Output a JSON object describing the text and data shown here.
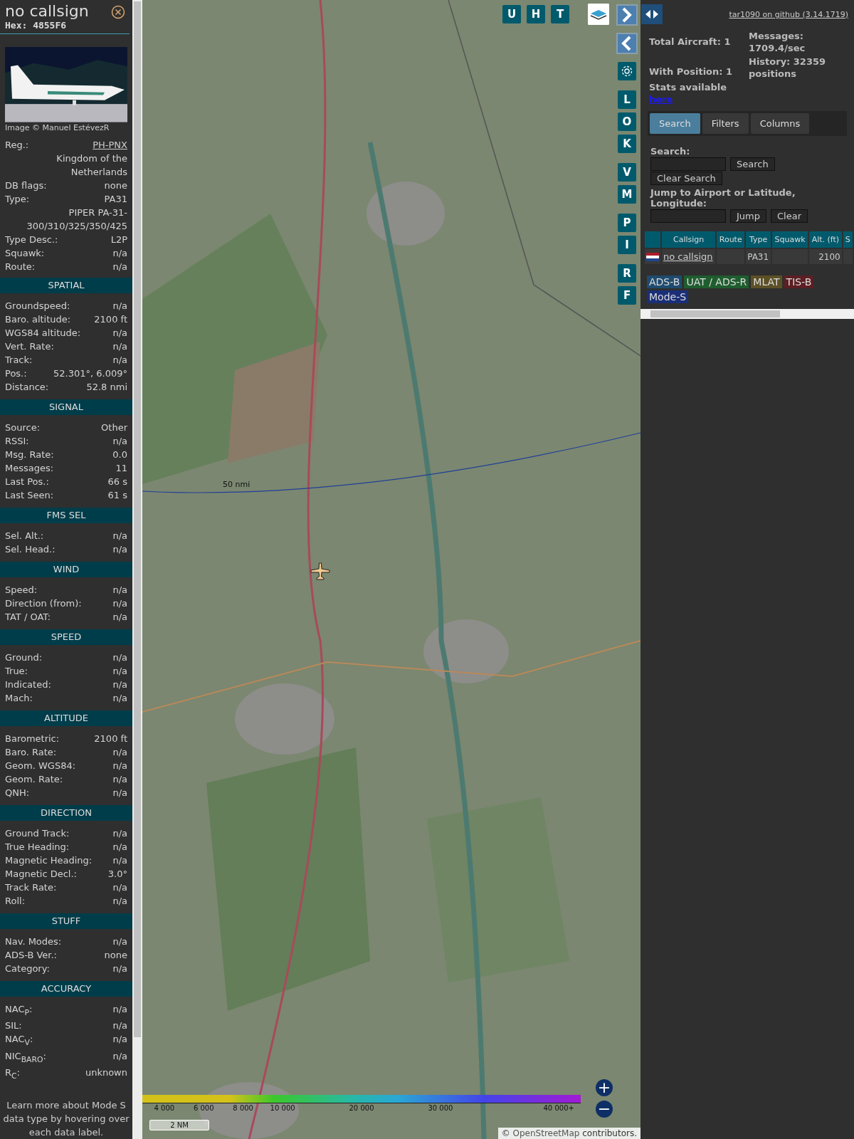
{
  "detail_panel": {
    "callsign": "no callsign",
    "hex": "Hex: 4855F6",
    "photo": {
      "kind": "picture",
      "credit": "Image © Manuel EstévezR"
    },
    "info_rows": [
      {
        "kind": "link",
        "label": "Reg.:",
        "value": "PH-PNX"
      },
      {
        "kind": "note",
        "value": "Kingdom of the Netherlands"
      },
      {
        "kind": "text",
        "label": "DB flags:",
        "value": "none"
      },
      {
        "kind": "text",
        "label": "Type:",
        "value": "PA31"
      },
      {
        "kind": "note",
        "value": "PIPER PA-31-300/310/325/350/425"
      },
      {
        "kind": "text",
        "label": "Type Desc.:",
        "value": "L2P"
      },
      {
        "kind": "text",
        "label": "Squawk:",
        "value": "n/a"
      },
      {
        "kind": "text",
        "label": "Route:",
        "value": "n/a"
      }
    ],
    "sections": [
      {
        "title": "SPATIAL",
        "rows": [
          {
            "label": "Groundspeed:",
            "value": "n/a"
          },
          {
            "label": "Baro. altitude:",
            "value": "2100 ft"
          },
          {
            "label": "WGS84 altitude:",
            "value": "n/a"
          },
          {
            "label": "Vert. Rate:",
            "value": "n/a"
          },
          {
            "label": "Track:",
            "value": "n/a"
          },
          {
            "label": "Pos.:",
            "value": "52.301°, 6.009°"
          },
          {
            "label": "Distance:",
            "value": "52.8 nmi"
          }
        ]
      },
      {
        "title": "SIGNAL",
        "rows": [
          {
            "label": "Source:",
            "value": "Other"
          },
          {
            "label": "RSSI:",
            "value": "n/a"
          },
          {
            "label": "Msg. Rate:",
            "value": "0.0"
          },
          {
            "label": "Messages:",
            "value": "11"
          },
          {
            "label": "Last Pos.:",
            "value": "66 s"
          },
          {
            "label": "Last Seen:",
            "value": "61 s"
          }
        ]
      },
      {
        "title": "FMS SEL",
        "rows": [
          {
            "label": "Sel. Alt.:",
            "value": "n/a"
          },
          {
            "label": "Sel. Head.:",
            "value": "n/a"
          }
        ]
      },
      {
        "title": "WIND",
        "rows": [
          {
            "label": "Speed:",
            "value": "n/a"
          },
          {
            "label": "Direction (from):",
            "value": "n/a"
          },
          {
            "label": "TAT / OAT:",
            "value": "n/a"
          }
        ]
      },
      {
        "title": "SPEED",
        "rows": [
          {
            "label": "Ground:",
            "value": "n/a"
          },
          {
            "label": "True:",
            "value": "n/a"
          },
          {
            "label": "Indicated:",
            "value": "n/a"
          },
          {
            "label": "Mach:",
            "value": "n/a"
          }
        ]
      },
      {
        "title": "ALTITUDE",
        "rows": [
          {
            "label": "Barometric:",
            "value": "2100 ft"
          },
          {
            "label": "Baro. Rate:",
            "value": "n/a"
          },
          {
            "label": "Geom. WGS84:",
            "value": "n/a"
          },
          {
            "label": "Geom. Rate:",
            "value": "n/a"
          },
          {
            "label": "QNH:",
            "value": "n/a"
          }
        ]
      },
      {
        "title": "DIRECTION",
        "rows": [
          {
            "label": "Ground Track:",
            "value": "n/a"
          },
          {
            "label": "True Heading:",
            "value": "n/a"
          },
          {
            "label": "Magnetic Heading:",
            "value": "n/a"
          },
          {
            "label": "Magnetic Decl.:",
            "value": "3.0°"
          },
          {
            "label": "Track Rate:",
            "value": "n/a"
          },
          {
            "label": "Roll:",
            "value": "n/a"
          }
        ]
      },
      {
        "title": "STUFF",
        "rows": [
          {
            "label": "Nav. Modes:",
            "value": "n/a"
          },
          {
            "label": "ADS-B Ver.:",
            "value": "none"
          },
          {
            "label": "Category:",
            "value": "n/a"
          }
        ]
      },
      {
        "title": "ACCURACY",
        "rows": [
          {
            "label": "NAC$_{P}$:",
            "value": "n/a"
          },
          {
            "label": "SIL:",
            "value": "n/a"
          },
          {
            "label": "NAC$_{V}$:",
            "value": "n/a"
          },
          {
            "label": "NIC$_{BARO}$:",
            "value": "n/a"
          },
          {
            "label": "R$_{C}$:",
            "value": "unknown"
          }
        ]
      }
    ],
    "footer": "Learn more about Mode S data type by hovering over each data label."
  },
  "map": {
    "kind": "picture",
    "top_buttons": [
      "U",
      "H",
      "T"
    ],
    "side_button_groups": [
      [
        "L",
        "O",
        "K"
      ],
      [
        "V",
        "M"
      ],
      [
        "P",
        "I"
      ],
      [
        "R",
        "F"
      ]
    ],
    "range_label": "50 nmi",
    "altitude_ticks": [
      "4 000",
      "6 000",
      "8 000",
      "10 000",
      "20 000",
      "30 000",
      "40 000+"
    ],
    "zoom_in": "+",
    "zoom_out": "−",
    "scale": "2 NM",
    "attribution": {
      "prefix": "©",
      "link": "OpenStreetMap",
      "suffix": "contributors."
    }
  },
  "side_panel": {
    "github_link": "tar1090 on github (3.14.1719)",
    "stats": {
      "total": "Total Aircraft: 1",
      "with_position": "With Position: 1",
      "stats_text": "Stats available",
      "stats_link": "here",
      "messages_label": "Messages:",
      "messages_value": "1709.4/sec",
      "history": "History: 32359 positions"
    },
    "tabs": [
      {
        "label": "Search",
        "selected": true
      },
      {
        "label": "Filters",
        "selected": false
      },
      {
        "label": "Columns",
        "selected": false
      }
    ],
    "search": {
      "label": "Search:",
      "button": "Search",
      "clear_button": "Clear Search"
    },
    "jump": {
      "label": "Jump to Airport or Latitude, Longitude:",
      "button": "Jump",
      "clear_button": "Clear"
    },
    "table": {
      "columns": [
        "Callsign",
        "Route",
        "Type",
        "Squawk",
        "Alt. (ft)",
        "S"
      ],
      "rows": [
        {
          "callsign": "no callsign",
          "type": "PA31",
          "altitude": "2100"
        }
      ]
    },
    "legend": [
      {
        "label": "ADS-B",
        "color": "#1f4b6e"
      },
      {
        "label": "UAT / ADS-R",
        "color": "#1f5d2f"
      },
      {
        "label": "MLAT",
        "color": "#5c5026"
      },
      {
        "label": "TIS-B",
        "color": "#5c1f24"
      },
      {
        "label": "Mode-S",
        "color": "#1b2f78"
      }
    ]
  }
}
